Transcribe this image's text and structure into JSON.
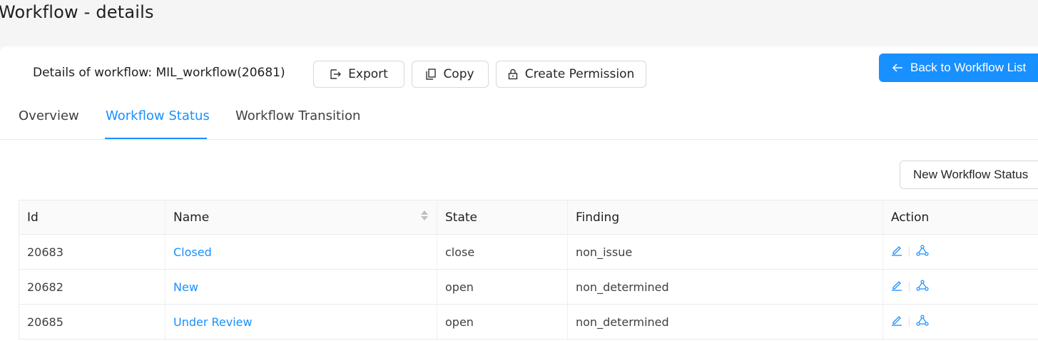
{
  "page": {
    "title": "Workflow - details"
  },
  "header": {
    "details_label": "Details of workflow: MIL_workflow(20681)",
    "export_label": "Export",
    "copy_label": "Copy",
    "create_permission_label": "Create Permission",
    "back_label": "Back to Workflow List"
  },
  "tabs": [
    {
      "label": "Overview",
      "active": false
    },
    {
      "label": "Workflow Status",
      "active": true
    },
    {
      "label": "Workflow Transition",
      "active": false
    }
  ],
  "new_status_label": "New Workflow Status",
  "table": {
    "columns": [
      "Id",
      "Name",
      "State",
      "Finding",
      "Action"
    ],
    "rows": [
      {
        "id": "20683",
        "name": "Closed",
        "state": "close",
        "finding": "non_issue"
      },
      {
        "id": "20682",
        "name": "New",
        "state": "open",
        "finding": "non_determined"
      },
      {
        "id": "20685",
        "name": "Under Review",
        "state": "open",
        "finding": "non_determined"
      }
    ]
  },
  "colors": {
    "accent": "#1890ff",
    "border": "#ebebeb",
    "header_bg": "#fafafa"
  },
  "icons": [
    "export-icon",
    "copy-icon",
    "lock-icon",
    "arrow-left-icon",
    "sort-icon",
    "edit-icon",
    "nodes-icon"
  ]
}
